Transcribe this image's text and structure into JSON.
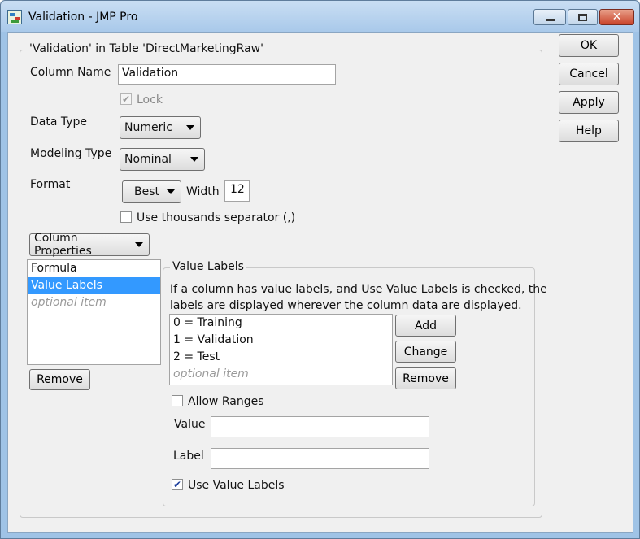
{
  "window": {
    "title": "Validation - JMP Pro",
    "minimize_icon": "minimize-icon",
    "maximize_icon": "maximize-icon",
    "close_icon": "close-icon",
    "close_glyph": "✕"
  },
  "main_group": {
    "legend": "'Validation' in Table 'DirectMarketingRaw'",
    "column_name_label": "Column Name",
    "column_name_value": "Validation",
    "lock_label": "Lock",
    "lock_checked": true,
    "data_type_label": "Data Type",
    "data_type_value": "Numeric",
    "modeling_type_label": "Modeling Type",
    "modeling_type_value": "Nominal",
    "format_label": "Format",
    "format_value": "Best",
    "width_label": "Width",
    "width_value": "12",
    "thousands_label": "Use thousands separator (,)",
    "thousands_checked": false
  },
  "column_properties": {
    "dropdown_label": "Column Properties",
    "items": [
      "Formula",
      "Value Labels"
    ],
    "selected_index": 1,
    "placeholder": "optional item",
    "remove_label": "Remove"
  },
  "value_labels": {
    "legend": "Value Labels",
    "description_line1": "If a column has value labels, and Use Value Labels is checked, the",
    "description_line2": "labels are displayed wherever the column data are displayed.",
    "items": [
      "0 = Training",
      "1 = Validation",
      "2 = Test"
    ],
    "placeholder": "optional item",
    "add_label": "Add",
    "change_label": "Change",
    "remove_label": "Remove",
    "allow_ranges_label": "Allow Ranges",
    "allow_ranges_checked": false,
    "value_label": "Value",
    "value_input": "",
    "label_label": "Label",
    "label_input": "",
    "use_value_labels_label": "Use Value Labels",
    "use_value_labels_checked": true
  },
  "side_buttons": {
    "ok": "OK",
    "cancel": "Cancel",
    "apply": "Apply",
    "help": "Help"
  },
  "checkmark_glyph": "✔"
}
